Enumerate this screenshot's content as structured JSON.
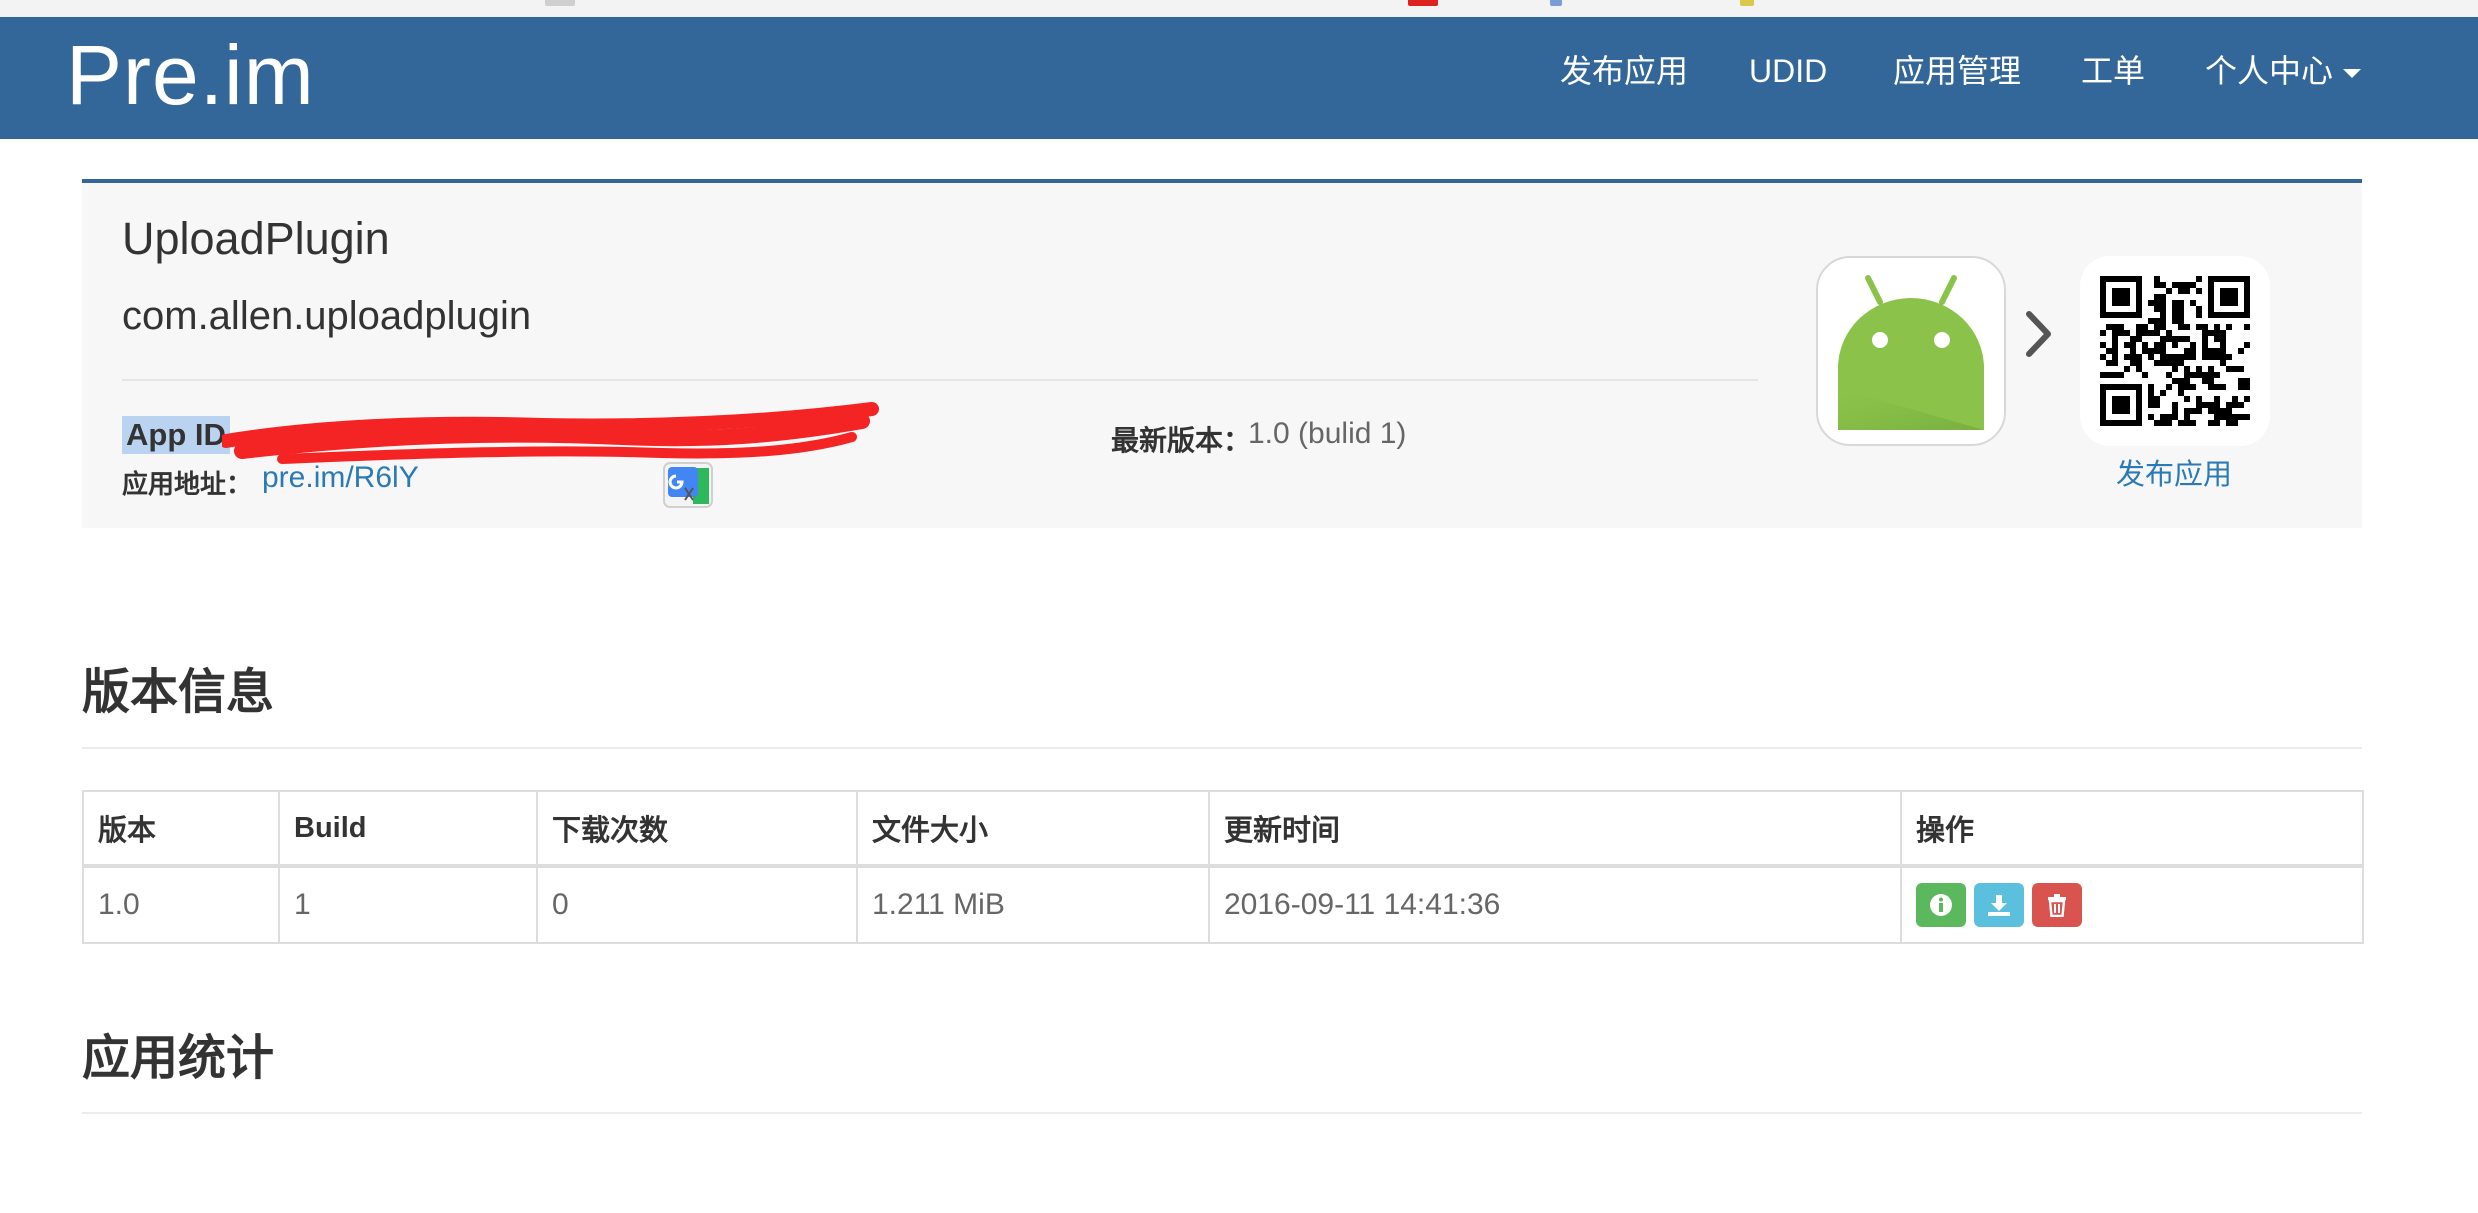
{
  "navbar": {
    "brand": "Pre.im",
    "items": [
      {
        "label": "发布应用"
      },
      {
        "label": "UDID"
      },
      {
        "label": "应用管理"
      },
      {
        "label": "工单"
      },
      {
        "label": "个人中心"
      }
    ]
  },
  "app": {
    "name": "UploadPlugin",
    "bundle_id": "com.allen.uploadplugin",
    "app_id_label": "App ID",
    "url_label": "应用地址",
    "url_separator": "：",
    "url": "pre.im/R6lY",
    "latest_version_label": "最新版本",
    "latest_version_separator": "：",
    "latest_version_value": "1.0 (bulid 1)",
    "publish_label": "发布应用",
    "icon": "android-icon"
  },
  "version_section": {
    "title": "版本信息",
    "columns": [
      "版本",
      "Build",
      "下载次数",
      "文件大小",
      "更新时间",
      "操作"
    ],
    "rows": [
      {
        "version": "1.0",
        "build": "1",
        "downloads": "0",
        "size": "1.211 MiB",
        "updated": "2016-09-11 14:41:36"
      }
    ],
    "actions": [
      "info-icon",
      "download-icon",
      "trash-icon"
    ]
  },
  "stats_section": {
    "title": "应用统计"
  },
  "colors": {
    "navbar": "#336699",
    "link": "#2a7ab7",
    "info_button": "#5cb85c",
    "download_button": "#5bc0de",
    "delete_button": "#d9534f",
    "android_green": "#8bc34a"
  }
}
